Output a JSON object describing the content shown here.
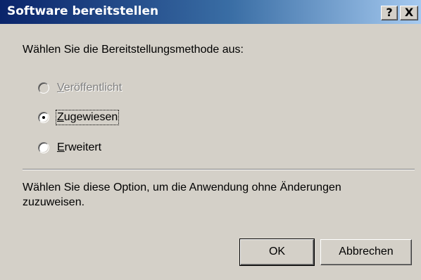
{
  "window": {
    "title": "Software bereitstellen",
    "help_button": "?",
    "close_button": "X"
  },
  "prompt": "Wählen Sie die Bereitstellungsmethode aus:",
  "options": [
    {
      "accel": "V",
      "rest": "eröffentlicht",
      "selected": false,
      "enabled": false
    },
    {
      "accel": "Z",
      "rest": "ugewiesen",
      "selected": true,
      "enabled": true
    },
    {
      "accel": "E",
      "rest": "rweitert",
      "selected": false,
      "enabled": true
    }
  ],
  "description": "Wählen Sie diese Option, um die Anwendung ohne Änderungen zuzuweisen.",
  "buttons": {
    "ok_label": "OK",
    "cancel_label": "Abbrechen"
  },
  "colors": {
    "title_gradient_start": "#0a246a",
    "title_gradient_end": "#a6caf0",
    "dialog_face": "#d4d0c8"
  }
}
